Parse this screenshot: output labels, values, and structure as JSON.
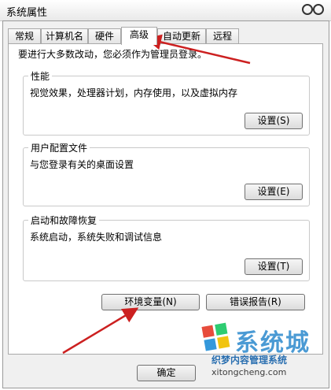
{
  "window": {
    "title": "系统属性"
  },
  "tabs": [
    "常规",
    "计算机名",
    "硬件",
    "高级",
    "自动更新",
    "远程"
  ],
  "active_tab": "高级",
  "intro": "要进行大多数改动，您必须作为管理员登录。",
  "performance": {
    "title": "性能",
    "desc": "视觉效果，处理器计划，内存使用，以及虚拟内存",
    "button": "设置(S)"
  },
  "profile": {
    "title": "用户配置文件",
    "desc": "与您登录有关的桌面设置",
    "button": "设置(E)"
  },
  "startup": {
    "title": "启动和故障恢复",
    "desc": "系统启动，系统失败和调试信息",
    "button": "设置(T)"
  },
  "buttons": {
    "env": "环境变量(N)",
    "error": "错误报告(R)",
    "ok": "确定"
  },
  "watermark": {
    "title": "系统城",
    "subtitle": "织梦内容管理系统",
    "url": "xitongcheng.com"
  },
  "colors": {
    "arrow": "#cc2020",
    "watermark": "#4a9ad4"
  }
}
